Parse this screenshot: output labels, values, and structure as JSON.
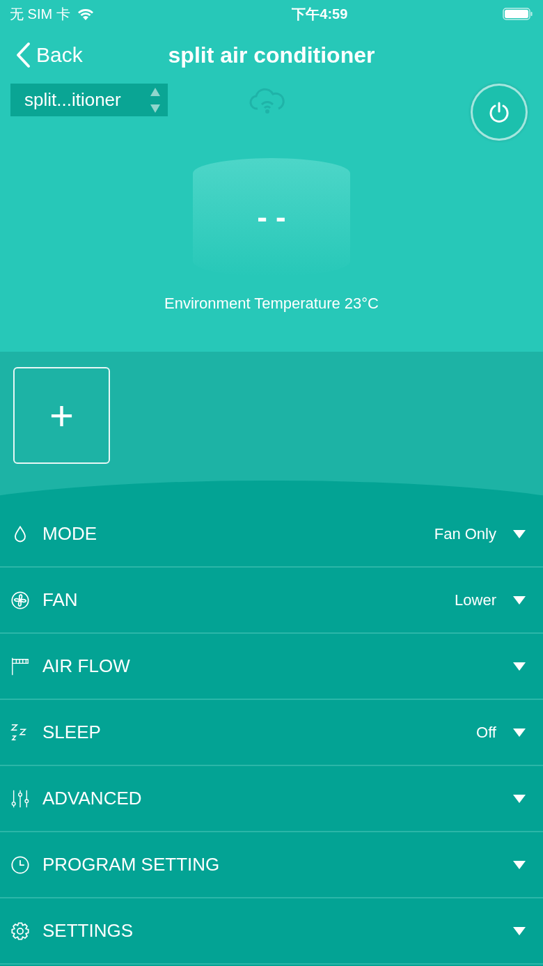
{
  "status_bar": {
    "carrier": "无 SIM 卡",
    "time": "下午4:59"
  },
  "nav": {
    "back": "Back",
    "title": "split air conditioner"
  },
  "device_selector": {
    "value": "split...itioner"
  },
  "display": {
    "temperature": "- -",
    "environment": "Environment Temperature 23°C"
  },
  "add_button": {
    "label": "+"
  },
  "settings": [
    {
      "kind": "mode",
      "label": "MODE",
      "value": "Fan Only"
    },
    {
      "kind": "fan",
      "label": "FAN",
      "value": "Lower"
    },
    {
      "kind": "airflow",
      "label": "AIR FLOW"
    },
    {
      "kind": "sleep",
      "label": "SLEEP",
      "value": "Off"
    },
    {
      "kind": "advanced",
      "label": "ADVANCED"
    },
    {
      "kind": "program",
      "label": "PROGRAM SETTING"
    },
    {
      "kind": "settings",
      "label": "SETTINGS"
    }
  ]
}
